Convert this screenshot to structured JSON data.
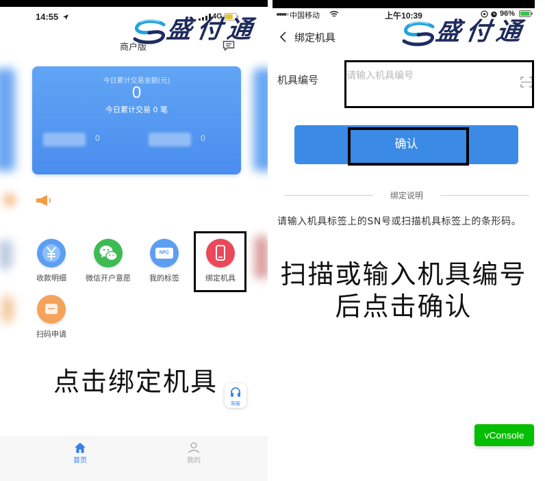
{
  "left_screen": {
    "status_bar": {
      "time": "14:55",
      "network": "4G"
    },
    "brand": {
      "logo_text": "盛付通",
      "edition": "商户版"
    },
    "summary_card": {
      "amount_label": "今日累计交易金额(元)",
      "amount": "0",
      "count_text": "今日累计交易 0 笔",
      "stats": [
        {
          "value": "0"
        },
        {
          "value": "0"
        }
      ]
    },
    "menu": [
      {
        "label": "收款明细",
        "icon": "yuan-coin-icon",
        "color": "#5c9ff2"
      },
      {
        "label": "微信开户意愿",
        "icon": "wechat-icon",
        "color": "#3dbb52"
      },
      {
        "label": "我的标签",
        "icon": "nfc-tag-icon",
        "icon_text": "NFC",
        "color": "#5c9ff2"
      },
      {
        "label": "绑定机具",
        "icon": "pos-device-icon",
        "color": "#e9495a"
      },
      {
        "label": "扫码申请",
        "icon": "scan-apply-icon",
        "color": "#f5a35c"
      }
    ],
    "instruction": "点击绑定机具",
    "service_button": {
      "label": "客服",
      "icon": "headset-icon"
    },
    "tabs": [
      {
        "label": "首页",
        "icon": "home-icon",
        "active": true
      },
      {
        "label": "我的",
        "icon": "person-icon",
        "active": false
      }
    ]
  },
  "right_screen": {
    "status_bar": {
      "carrier": "中国移动",
      "time": "上午10:39",
      "battery": "96%"
    },
    "nav": {
      "back_icon": "chevron-left-icon",
      "title": "绑定机具",
      "logo_text": "盛付通"
    },
    "form": {
      "label": "机具编号",
      "placeholder": "请输入机具编号",
      "scan_icon": "scan-icon"
    },
    "confirm_button": {
      "label": "确认",
      "color": "#3b8be6"
    },
    "notes": {
      "heading": "绑定说明",
      "text": "请输入机具标签上的SN号或扫描机具标签上的条形码。"
    },
    "instruction": {
      "line1": "扫描或输入机具编号",
      "line2": "后点击确认"
    },
    "vconsole": {
      "label": "vConsole",
      "color": "#04be02"
    }
  }
}
